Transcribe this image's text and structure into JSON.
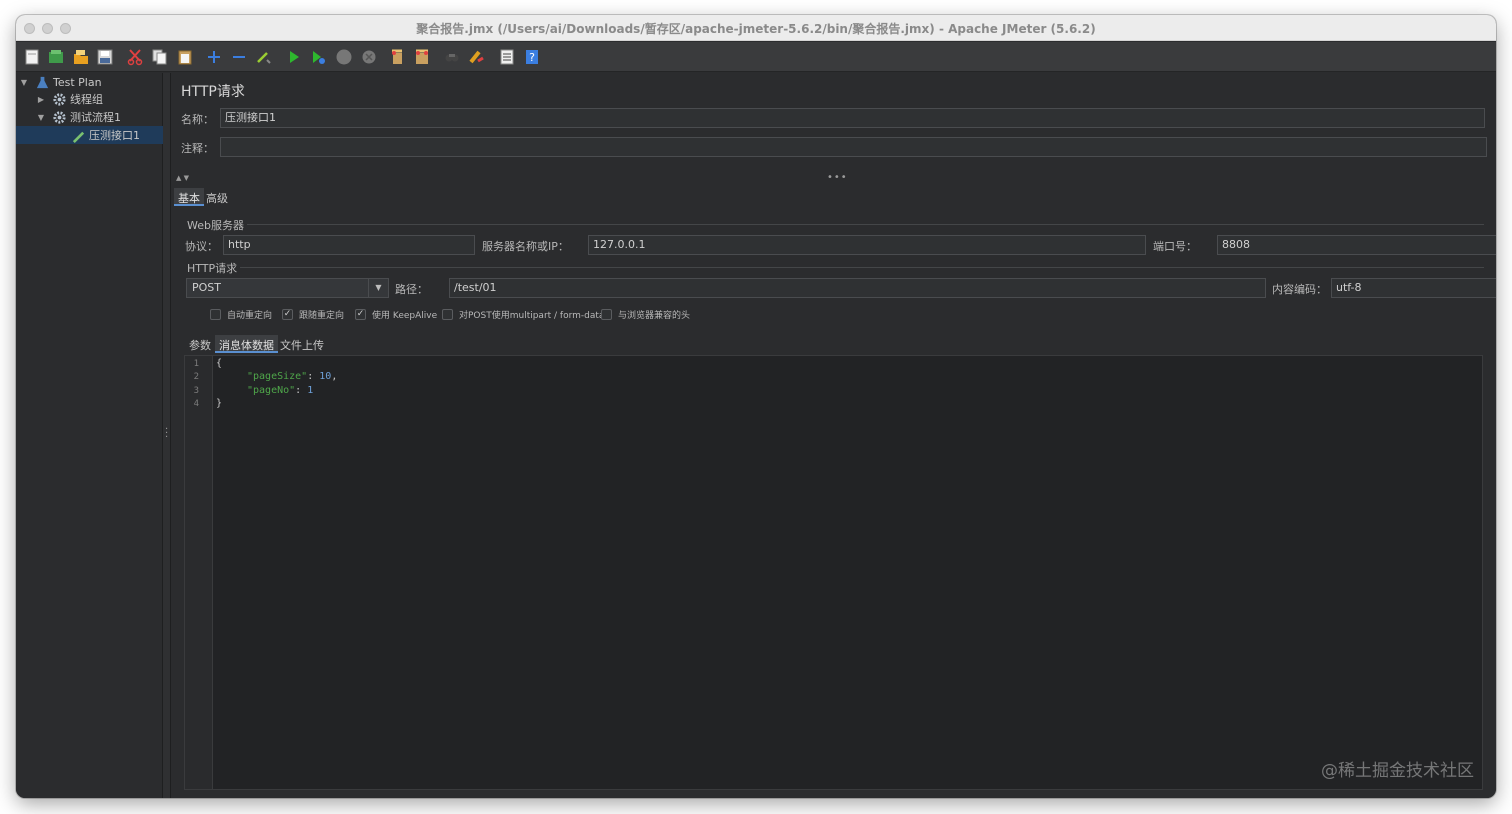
{
  "window": {
    "title": "聚合报告.jmx (/Users/ai/Downloads/暂存区/apache-jmeter-5.6.2/bin/聚合报告.jmx) - Apache JMeter (5.6.2)"
  },
  "toolbar": {
    "icons": [
      "new-icon",
      "templates-icon",
      "open-icon",
      "save-icon",
      "cut-icon",
      "copy-icon",
      "paste-icon",
      "expand-icon",
      "collapse-icon",
      "toggle-icon",
      "start-icon",
      "start-no-pause-icon",
      "stop-icon",
      "shutdown-icon",
      "clear-icon",
      "clear-all-icon",
      "search-icon",
      "reset-search-icon",
      "function-helper-icon",
      "help-icon"
    ]
  },
  "tree": {
    "items": [
      {
        "label": "Test Plan",
        "level": 0,
        "expanded": true
      },
      {
        "label": "线程组",
        "level": 1,
        "expanded": false
      },
      {
        "label": "测试流程1",
        "level": 1,
        "expanded": true
      },
      {
        "label": "压测接口1",
        "level": 2,
        "selected": true
      }
    ]
  },
  "panel": {
    "heading": "HTTP请求",
    "name_label": "名称：",
    "name_value": "压测接口1",
    "comment_label": "注释：",
    "comment_value": "",
    "tabs": [
      "基本",
      "高级"
    ],
    "active_tab": "基本",
    "web_server": {
      "title": "Web服务器",
      "protocol_label": "协议：",
      "protocol_value": "http",
      "server_label": "服务器名称或IP：",
      "server_value": "127.0.0.1",
      "port_label": "端口号：",
      "port_value": "8808"
    },
    "http_request": {
      "title": "HTTP请求",
      "method": "POST",
      "path_label": "路径：",
      "path_value": "/test/01",
      "encoding_label": "内容编码：",
      "encoding_value": "utf-8"
    },
    "checkboxes": [
      {
        "label": "自动重定向",
        "checked": false
      },
      {
        "label": "跟随重定向",
        "checked": true
      },
      {
        "label": "使用 KeepAlive",
        "checked": true
      },
      {
        "label": "对POST使用multipart / form-data",
        "checked": false
      },
      {
        "label": "与浏览器兼容的头",
        "checked": false
      }
    ],
    "subtabs": [
      "参数",
      "消息体数据",
      "文件上传"
    ],
    "active_subtab": "消息体数据",
    "body": {
      "line_numbers": [
        "1",
        "2",
        "3",
        "4"
      ],
      "open_brace": "{",
      "key1": "\"pageSize\"",
      "sep1": ": ",
      "val1": "10",
      "comma": ",",
      "key2": "\"pageNo\"",
      "sep2": ": ",
      "val2": "1",
      "close_brace": "}"
    }
  },
  "watermark": "@稀土掘金技术社区"
}
